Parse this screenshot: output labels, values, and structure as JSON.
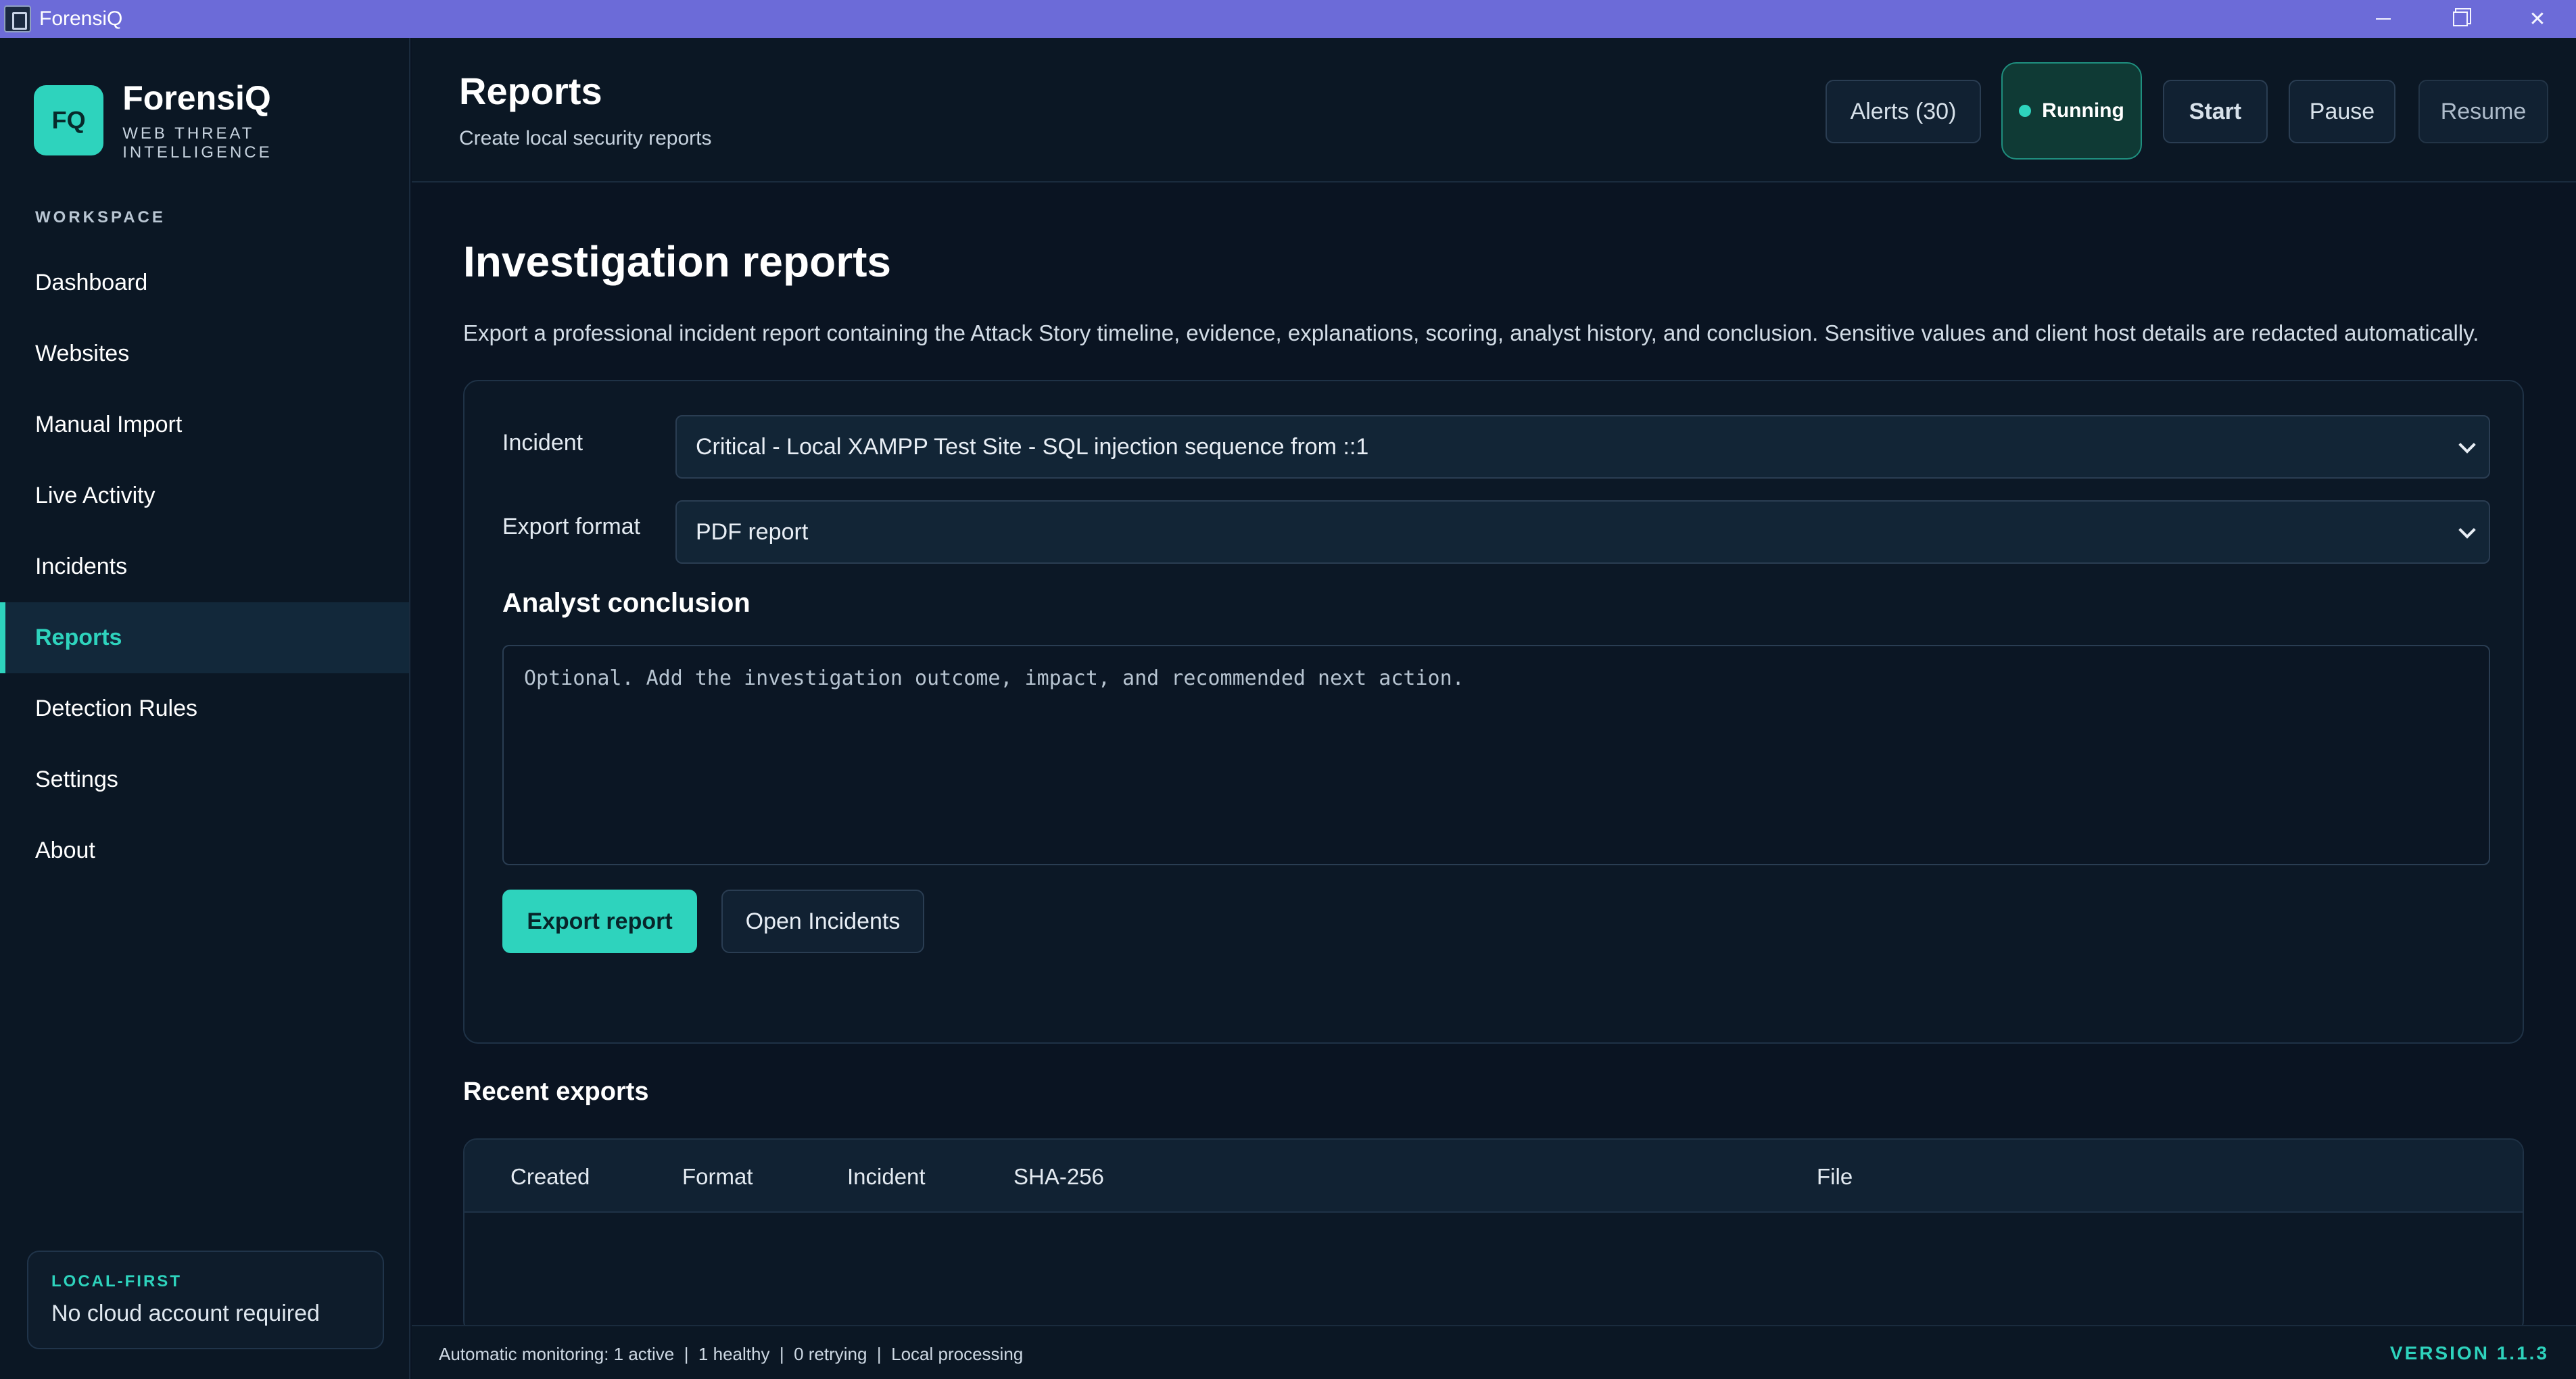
{
  "window": {
    "title": "ForensiQ",
    "icon": "app-icon"
  },
  "brand": {
    "logo": "FQ",
    "name": "ForensiQ",
    "tagline": "WEB THREAT INTELLIGENCE"
  },
  "sidebar": {
    "section_label": "WORKSPACE",
    "items": [
      {
        "label": "Dashboard"
      },
      {
        "label": "Websites"
      },
      {
        "label": "Manual Import"
      },
      {
        "label": "Live Activity"
      },
      {
        "label": "Incidents"
      },
      {
        "label": "Reports",
        "active": true
      },
      {
        "label": "Detection Rules"
      },
      {
        "label": "Settings"
      },
      {
        "label": "About"
      }
    ],
    "footer": {
      "label": "LOCAL-FIRST",
      "text": "No cloud account required"
    }
  },
  "header": {
    "title": "Reports",
    "subtitle": "Create local security reports",
    "buttons": {
      "alerts": "Alerts (30)",
      "running": "Running",
      "start": "Start",
      "pause": "Pause",
      "resume": "Resume"
    }
  },
  "main": {
    "title": "Investigation reports",
    "description": "Export a professional incident report containing the Attack Story timeline, evidence, explanations, scoring, analyst history, and conclusion. Sensitive values and client host details are redacted automatically.",
    "form": {
      "incident_label": "Incident",
      "incident_value": "Critical - Local XAMPP Test Site - SQL injection sequence from ::1",
      "format_label": "Export format",
      "format_value": "PDF report",
      "conclusion_heading": "Analyst conclusion",
      "conclusion_placeholder": "Optional. Add the investigation outcome, impact, and recommended next action.",
      "export_button": "Export report",
      "open_incidents_button": "Open Incidents"
    },
    "recent": {
      "title": "Recent exports",
      "columns": [
        "Created",
        "Format",
        "Incident",
        "SHA-256",
        "File"
      ],
      "rows": []
    }
  },
  "statusbar": {
    "text": "Automatic monitoring: 1 active  |  1 healthy  |  0 retrying  |  Local processing",
    "version": "VERSION 1.1.3"
  },
  "colors": {
    "accent": "#2ed3bd",
    "titlebar": "#6c6bd8",
    "background": "#0a1422"
  }
}
